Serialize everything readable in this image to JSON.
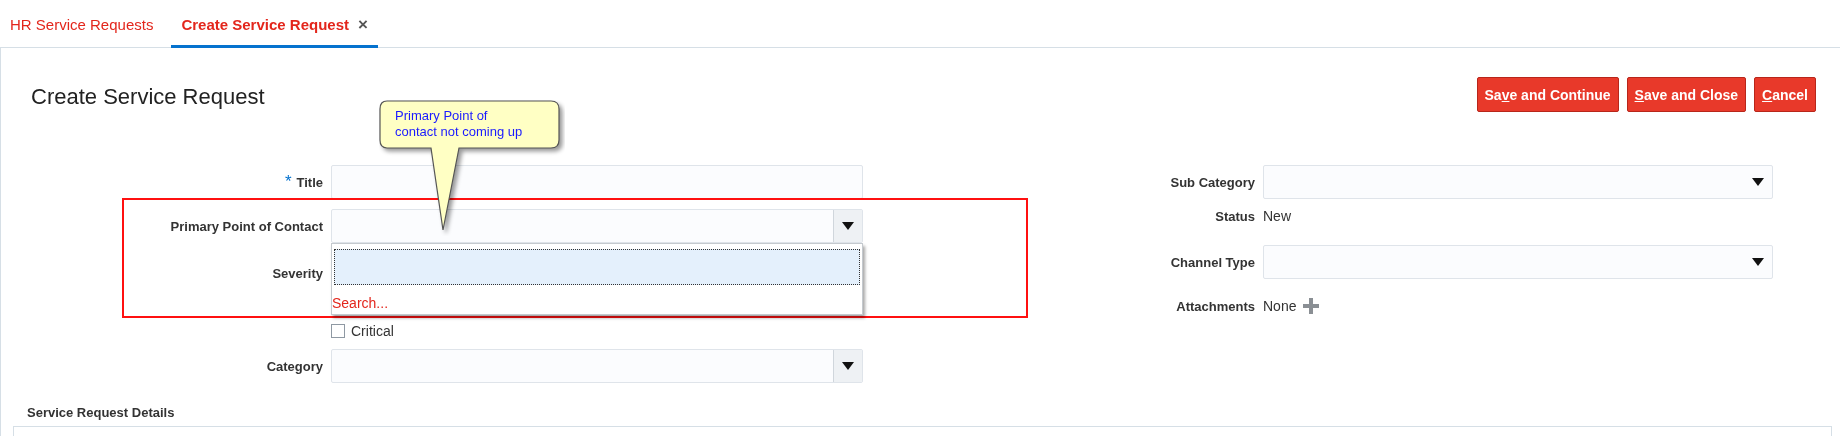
{
  "tabs": [
    {
      "label": "HR Service Requests",
      "selected": false
    },
    {
      "label": "Create Service Request",
      "selected": true,
      "close_icon": "×"
    }
  ],
  "page_title": "Create Service Request",
  "buttons": [
    {
      "before": "Sa",
      "key": "v",
      "after": "e and Continue"
    },
    {
      "key": "S",
      "after": "ave and Close"
    },
    {
      "key": "C",
      "after": "ancel"
    }
  ],
  "left_fields": [
    {
      "kind": "text",
      "label": "Title",
      "required_mark": "*"
    },
    {
      "kind": "select",
      "label": "Primary Point of Contact",
      "open": true,
      "popup": {
        "options": [
          {
            "selected": true
          }
        ],
        "search_link": "Search..."
      }
    },
    {
      "kind": "options",
      "label": "Severity",
      "options": [
        {
          "label": "Critical",
          "checked": false
        }
      ]
    },
    {
      "kind": "select",
      "label": "Category",
      "open": false
    }
  ],
  "right_fields": [
    {
      "kind": "select",
      "label": "Sub Category",
      "open": false
    },
    {
      "kind": "value",
      "label": "Status",
      "value": "New"
    },
    {
      "kind": "select",
      "label": "Channel Type",
      "open": false
    },
    {
      "kind": "value",
      "label": "Attachments",
      "value": "None",
      "add_icon": true
    }
  ],
  "annotation": {
    "callout": "Primary Point of\ncontact not coming up"
  },
  "section_title": "Service Request Details"
}
